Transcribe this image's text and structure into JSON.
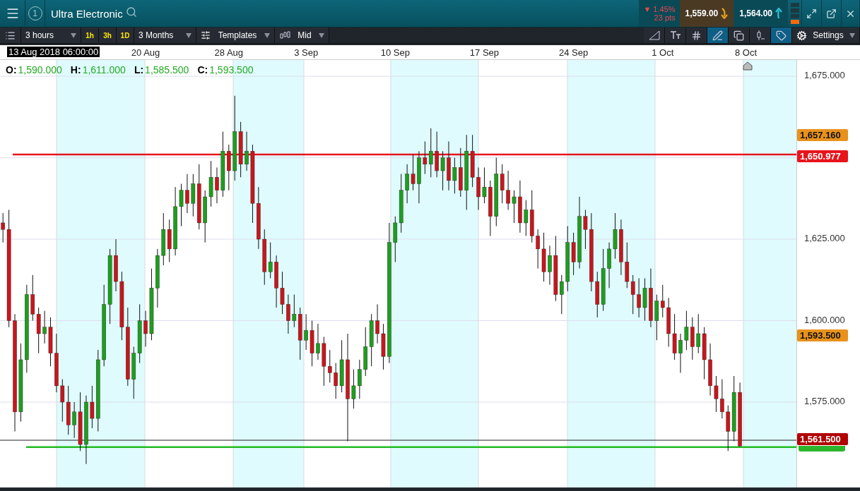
{
  "header": {
    "tab_number": "1",
    "instrument": "Ultra Electronic",
    "change": {
      "arrow": "▼",
      "percent": "1.45%",
      "points": "23 pts"
    },
    "sell": "1,559.00",
    "buy": "1,564.00"
  },
  "toolbar": {
    "interval": "3 hours",
    "quick_intervals": [
      "1h",
      "3h",
      "1D"
    ],
    "range": "3 Months",
    "templates": "Templates",
    "price_type": "Mid",
    "settings": "Settings",
    "tools": [
      {
        "kind": "trend",
        "selected": false
      },
      {
        "kind": "text",
        "selected": false
      },
      {
        "kind": "grid",
        "selected": false
      },
      {
        "kind": "draw",
        "selected": true
      },
      {
        "kind": "layers",
        "selected": false
      },
      {
        "kind": "candle",
        "selected": false
      },
      {
        "kind": "tag",
        "selected": true
      }
    ]
  },
  "chart": {
    "cursor_time": "13 Aug 2018 06:00:00",
    "ohlc_legend": [
      {
        "label": "O:",
        "value": "1,590.000"
      },
      {
        "label": "H:",
        "value": "1,611.000"
      },
      {
        "label": "L:",
        "value": "1,585.500"
      },
      {
        "label": "C:",
        "value": "1,593.500"
      }
    ],
    "price_tags": [
      {
        "kind": "level",
        "text": "1,657.160"
      },
      {
        "kind": "line",
        "text": "1,650.977"
      },
      {
        "kind": "close",
        "text": "1,593.500"
      },
      {
        "kind": "last",
        "text": "1,561.500"
      }
    ],
    "chart_data": {
      "type": "candlestick",
      "ylim": [
        1548.8,
        1680
      ],
      "grid": true,
      "ref_lines": [
        {
          "axis": "y",
          "value": 1650.977,
          "color": "#e8141c"
        },
        {
          "axis": "y",
          "value": 1563.3,
          "color": "#222222"
        },
        {
          "axis": "y",
          "value": 1561.2,
          "color": "#22bb22"
        }
      ],
      "categories": [
        null,
        null,
        null,
        null,
        null,
        null,
        null,
        null,
        null,
        null,
        null,
        null,
        null,
        null,
        null,
        null,
        null,
        null,
        null,
        null,
        null,
        null,
        null,
        null,
        "20 Aug",
        null,
        null,
        null,
        null,
        null,
        null,
        null,
        null,
        null,
        null,
        null,
        null,
        null,
        "28 Aug",
        null,
        null,
        null,
        null,
        null,
        null,
        null,
        null,
        null,
        null,
        null,
        null,
        "3 Sep",
        null,
        null,
        null,
        null,
        null,
        null,
        null,
        null,
        null,
        null,
        null,
        null,
        null,
        null,
        "10 Sep",
        null,
        null,
        null,
        null,
        null,
        null,
        null,
        null,
        null,
        null,
        null,
        null,
        null,
        null,
        "17 Sep",
        null,
        null,
        null,
        null,
        null,
        null,
        null,
        null,
        null,
        null,
        null,
        null,
        null,
        null,
        "24 Sep",
        null,
        null,
        null,
        null,
        null,
        null,
        null,
        null,
        null,
        null,
        null,
        null,
        null,
        null,
        "1 Oct",
        null,
        null,
        null,
        null,
        null,
        null,
        null,
        null,
        null,
        null,
        null,
        null,
        null,
        "8 Oct",
        null,
        null,
        null,
        null,
        null,
        null,
        null,
        null
      ],
      "yticks": [
        {
          "value": 1675,
          "label": "1,675.000"
        },
        {
          "value": 1625,
          "label": "1,625.000"
        },
        {
          "value": 1600,
          "label": "1,600.000"
        },
        {
          "value": 1575,
          "label": "1,575.000"
        }
      ],
      "ohlc": [
        [
          1630,
          1633,
          1624,
          1628
        ],
        [
          1628,
          1634,
          1598,
          1600
        ],
        [
          1600,
          1602,
          1566,
          1572
        ],
        [
          1572,
          1593,
          1569,
          1588
        ],
        [
          1588,
          1611,
          1584,
          1608
        ],
        [
          1608,
          1614,
          1600,
          1602
        ],
        [
          1602,
          1604,
          1590,
          1596
        ],
        [
          1596,
          1603,
          1593,
          1598
        ],
        [
          1598,
          1601,
          1586,
          1590
        ],
        [
          1590,
          1596,
          1578,
          1580
        ],
        [
          1580,
          1582,
          1569,
          1575
        ],
        [
          1575,
          1580,
          1565,
          1568
        ],
        [
          1568,
          1575,
          1564,
          1572
        ],
        [
          1572,
          1578,
          1560,
          1562
        ],
        [
          1562,
          1577,
          1556,
          1575
        ],
        [
          1575,
          1580,
          1567,
          1570
        ],
        [
          1570,
          1591,
          1566,
          1588
        ],
        [
          1588,
          1611,
          1586,
          1605
        ],
        [
          1605,
          1622,
          1599,
          1620
        ],
        [
          1620,
          1625,
          1609,
          1612
        ],
        [
          1612,
          1615,
          1594,
          1598
        ],
        [
          1598,
          1604,
          1580,
          1582
        ],
        [
          1582,
          1592,
          1576,
          1590
        ],
        [
          1590,
          1605,
          1587,
          1600
        ],
        [
          1600,
          1603,
          1592,
          1596
        ],
        [
          1596,
          1616,
          1594,
          1610
        ],
        [
          1610,
          1622,
          1604,
          1620
        ],
        [
          1620,
          1633,
          1617,
          1628
        ],
        [
          1628,
          1631,
          1618,
          1622
        ],
        [
          1622,
          1641,
          1620,
          1635
        ],
        [
          1635,
          1642,
          1629,
          1640
        ],
        [
          1640,
          1645,
          1633,
          1636
        ],
        [
          1636,
          1645,
          1632,
          1642
        ],
        [
          1642,
          1648,
          1628,
          1630
        ],
        [
          1630,
          1640,
          1624,
          1638
        ],
        [
          1638,
          1649,
          1635,
          1644
        ],
        [
          1644,
          1647,
          1636,
          1640
        ],
        [
          1640,
          1658,
          1638,
          1652
        ],
        [
          1652,
          1654,
          1640,
          1646
        ],
        [
          1646,
          1669,
          1643,
          1658
        ],
        [
          1658,
          1661,
          1644,
          1648
        ],
        [
          1648,
          1658,
          1646,
          1652
        ],
        [
          1652,
          1654,
          1630,
          1636
        ],
        [
          1636,
          1641,
          1622,
          1625
        ],
        [
          1625,
          1628,
          1611,
          1615
        ],
        [
          1615,
          1624,
          1613,
          1618
        ],
        [
          1618,
          1620,
          1604,
          1610
        ],
        [
          1610,
          1615,
          1602,
          1605
        ],
        [
          1605,
          1608,
          1596,
          1600
        ],
        [
          1600,
          1608,
          1598,
          1602
        ],
        [
          1602,
          1604,
          1588,
          1594
        ],
        [
          1594,
          1602,
          1591,
          1597
        ],
        [
          1597,
          1600,
          1586,
          1590
        ],
        [
          1590,
          1599,
          1588,
          1593
        ],
        [
          1593,
          1595,
          1580,
          1586
        ],
        [
          1586,
          1591,
          1581,
          1584
        ],
        [
          1584,
          1587,
          1576,
          1580
        ],
        [
          1580,
          1594,
          1578,
          1588
        ],
        [
          1588,
          1596,
          1563,
          1576
        ],
        [
          1576,
          1585,
          1573,
          1580
        ],
        [
          1580,
          1588,
          1576,
          1585
        ],
        [
          1585,
          1598,
          1583,
          1592
        ],
        [
          1592,
          1602,
          1586,
          1600
        ],
        [
          1600,
          1605,
          1593,
          1596
        ],
        [
          1596,
          1599,
          1585,
          1589
        ],
        [
          1589,
          1630,
          1587,
          1624
        ],
        [
          1624,
          1632,
          1618,
          1630
        ],
        [
          1630,
          1645,
          1627,
          1640
        ],
        [
          1640,
          1648,
          1636,
          1645
        ],
        [
          1645,
          1651,
          1640,
          1642
        ],
        [
          1642,
          1652,
          1636,
          1650
        ],
        [
          1650,
          1655,
          1645,
          1648
        ],
        [
          1648,
          1659,
          1644,
          1652
        ],
        [
          1652,
          1658,
          1644,
          1646
        ],
        [
          1646,
          1652,
          1640,
          1650
        ],
        [
          1650,
          1655,
          1640,
          1643
        ],
        [
          1643,
          1650,
          1639,
          1647
        ],
        [
          1647,
          1653,
          1638,
          1640
        ],
        [
          1640,
          1657,
          1634,
          1652
        ],
        [
          1652,
          1657,
          1641,
          1644
        ],
        [
          1644,
          1647,
          1634,
          1638
        ],
        [
          1638,
          1647,
          1636,
          1641
        ],
        [
          1641,
          1643,
          1626,
          1632
        ],
        [
          1632,
          1650,
          1629,
          1645
        ],
        [
          1645,
          1648,
          1636,
          1640
        ],
        [
          1640,
          1646,
          1634,
          1636
        ],
        [
          1636,
          1640,
          1630,
          1638
        ],
        [
          1638,
          1643,
          1627,
          1630
        ],
        [
          1630,
          1637,
          1626,
          1634
        ],
        [
          1634,
          1640,
          1624,
          1626
        ],
        [
          1626,
          1628,
          1616,
          1622
        ],
        [
          1622,
          1627,
          1612,
          1615
        ],
        [
          1615,
          1623,
          1611,
          1620
        ],
        [
          1620,
          1626,
          1606,
          1608
        ],
        [
          1608,
          1614,
          1602,
          1612
        ],
        [
          1612,
          1629,
          1609,
          1624
        ],
        [
          1624,
          1627,
          1614,
          1618
        ],
        [
          1618,
          1638,
          1616,
          1632
        ],
        [
          1632,
          1634,
          1622,
          1628
        ],
        [
          1628,
          1633,
          1609,
          1612
        ],
        [
          1612,
          1615,
          1601,
          1605
        ],
        [
          1605,
          1622,
          1603,
          1616
        ],
        [
          1616,
          1624,
          1610,
          1622
        ],
        [
          1622,
          1633,
          1619,
          1628
        ],
        [
          1628,
          1631,
          1614,
          1618
        ],
        [
          1618,
          1624,
          1610,
          1612
        ],
        [
          1612,
          1614,
          1602,
          1608
        ],
        [
          1608,
          1613,
          1601,
          1604
        ],
        [
          1604,
          1613,
          1600,
          1610
        ],
        [
          1610,
          1616,
          1598,
          1600
        ],
        [
          1600,
          1608,
          1594,
          1606
        ],
        [
          1606,
          1611,
          1601,
          1604
        ],
        [
          1604,
          1607,
          1592,
          1596
        ],
        [
          1596,
          1602,
          1588,
          1590
        ],
        [
          1590,
          1596,
          1584,
          1594
        ],
        [
          1594,
          1603,
          1591,
          1598
        ],
        [
          1598,
          1601,
          1588,
          1592
        ],
        [
          1592,
          1602,
          1590,
          1596
        ],
        [
          1596,
          1598,
          1582,
          1588
        ],
        [
          1588,
          1593,
          1577,
          1580
        ],
        [
          1580,
          1583,
          1572,
          1576
        ],
        [
          1576,
          1582,
          1570,
          1572
        ],
        [
          1572,
          1574,
          1560,
          1566
        ],
        [
          1566,
          1583,
          1563,
          1578
        ],
        [
          1578,
          1581,
          1561.5,
          1561.5
        ],
        null,
        null,
        null,
        null,
        null,
        null,
        null,
        null,
        null
      ]
    }
  }
}
